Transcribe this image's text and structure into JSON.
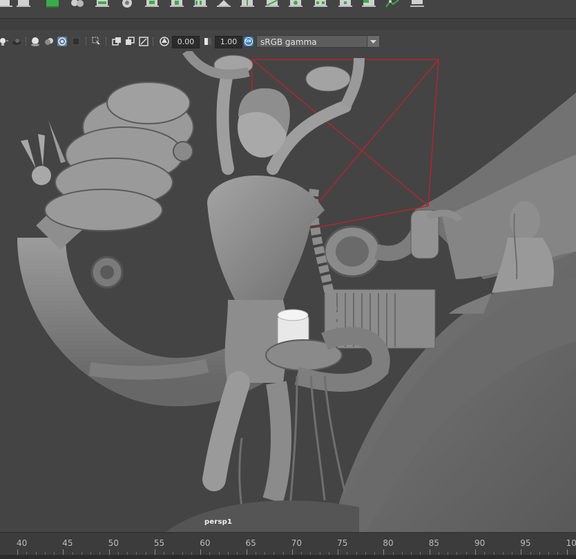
{
  "panel_toolbar": {
    "exposure_value": "0.00",
    "gamma_value": "1.00",
    "color_space": "sRGB gamma",
    "color_mgmt_badge": "ON"
  },
  "viewport": {
    "camera_label": "persp1"
  },
  "time_slider": {
    "ticks": [
      "40",
      "45",
      "50",
      "55",
      "60",
      "65",
      "70",
      "75",
      "80",
      "85",
      "90",
      "95",
      "10"
    ]
  },
  "colors": {
    "viewport_bg": "#444444",
    "camera_frustum": "#b0262d",
    "model_gray": "#8f8f8f"
  },
  "icons": {
    "shelf": [
      "polygon-sphere-icon",
      "polygon-grid-icon",
      "smooth-mesh-icon",
      "combine-icon",
      "extrude-icon",
      "polygon-cube-icon",
      "bevel-icon",
      "bridge-icon",
      "append-icon",
      "fill-hole-icon",
      "insert-edge-loop-icon",
      "multi-cut-icon",
      "merge-icon",
      "target-weld-icon",
      "collapse-icon",
      "uv-editor-icon",
      "uv-layout-icon"
    ],
    "panel": [
      "light-bulb-icon",
      "shadows-icon",
      "ambient-occlusion-icon",
      "motion-blur-icon",
      "anti-aliasing-icon",
      "depth-of-field-icon",
      "isolate-select-icon",
      "xray-icon",
      "xray-joints-icon",
      "backface-culling-icon",
      "exposure-icon",
      "gamma-icon",
      "color-management-icon"
    ]
  }
}
